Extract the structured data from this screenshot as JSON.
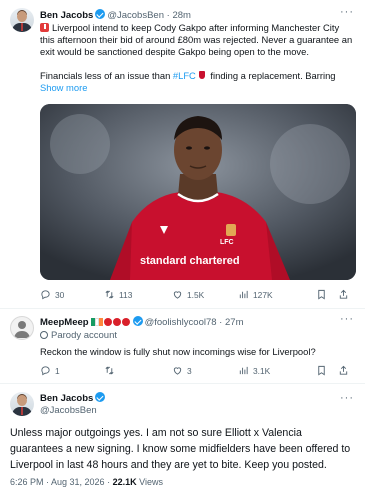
{
  "tweet1": {
    "name": "Ben Jacobs",
    "handle": "@JacobsBen",
    "time": "28m",
    "line1": "Liverpool intend to keep Cody Gakpo after informing Manchester City",
    "line2": "this afternoon their bid of around £80m was rejected. Never a guarantee an",
    "line3": "exit would be sanctioned despite Gakpo being open to the move.",
    "line4_pre": "Financials less of an issue than ",
    "hashtag": "#LFC",
    "line4_post": " finding a replacement. Barring",
    "show_more": "Show more",
    "stats": {
      "replies": "30",
      "reposts": "113",
      "likes": "1.5K",
      "views": "127K"
    }
  },
  "tweet2": {
    "name": "MeepMeep",
    "handle": "@foolishlycool78",
    "time": "27m",
    "badge": "Parody account",
    "text": "Reckon the window is fully shut now incomings wise for Liverpool?",
    "stats": {
      "replies": "1",
      "reposts": "",
      "likes": "3",
      "views": "3.1K"
    }
  },
  "tweet3": {
    "name": "Ben Jacobs",
    "handle": "@JacobsBen",
    "line1": "Unless major outgoings yes. I am not so sure Elliott x Valencia",
    "line2": "guarantees a new signing. I know some midfielders have been offered to",
    "line3": "Liverpool in last 48 hours and they are yet to bite. Keep you posted.",
    "timestamp": "6:26 PM · Aug 31, 2026 · ",
    "views_count": "22.1K",
    "views_label": " Views"
  },
  "photo": {
    "shirt_sponsor": "standard chartered",
    "shirt_brand": "LFC"
  },
  "colors": {
    "accent": "#1d9bf0",
    "muted": "#536471",
    "text": "#0f1419"
  },
  "icons": [
    "verified-badge-icon",
    "more-icon",
    "reply-icon",
    "repost-icon",
    "like-icon",
    "views-icon",
    "bookmark-icon",
    "share-icon",
    "alert-icon",
    "liverpool-badge-icon"
  ]
}
